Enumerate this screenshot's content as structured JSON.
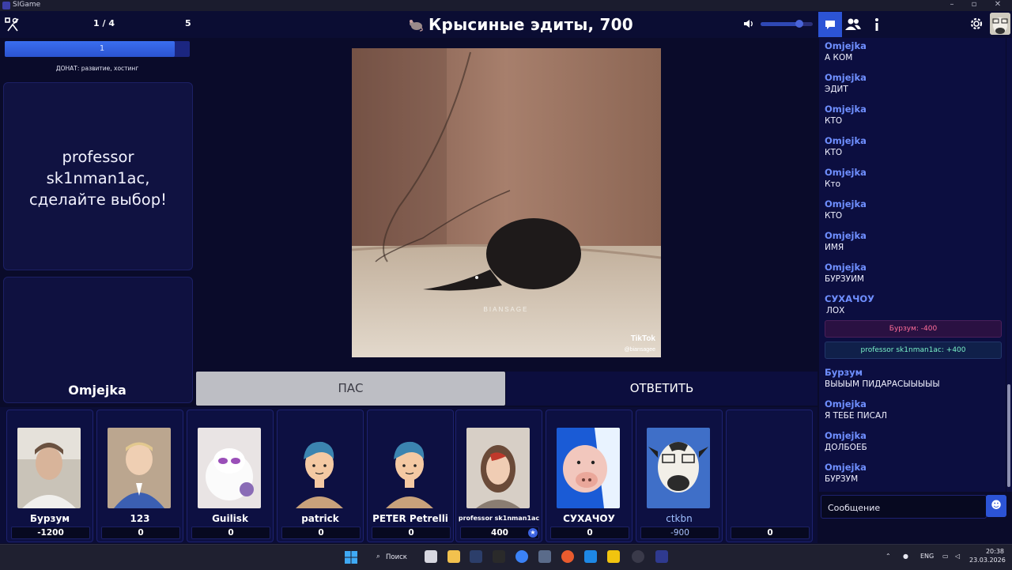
{
  "window": {
    "app_name": "SIGame"
  },
  "topbar": {
    "round": "1 / 4",
    "round_number": "5",
    "title": "Крысиные эдиты, 700"
  },
  "left_panel": {
    "progress_label": "1",
    "progress_fraction": 0.92,
    "donate": "ДОНАТ: развитие, хостинг",
    "prompt": "professor sk1nman1ac, сделайте выбор!",
    "chooser": "Omjejka"
  },
  "media": {
    "watermark": "BIANSAGE",
    "tiktok_label": "TikTok",
    "tiktok_handle": "@biansagee"
  },
  "buttons": {
    "pass": "ПАС",
    "answer": "ОТВЕТИТЬ"
  },
  "players": [
    {
      "name": "Бурзум",
      "score": "-1200"
    },
    {
      "name": "123",
      "score": "0"
    },
    {
      "name": "Guilisk",
      "score": "0"
    },
    {
      "name": "patrick",
      "score": "0"
    },
    {
      "name": "PETER Petrelli",
      "score": "0"
    },
    {
      "name": "professor sk1nman1ac",
      "score": "400"
    },
    {
      "name": "СУХАЧОУ",
      "score": "0"
    },
    {
      "name": "ctkbn",
      "score": "-900"
    },
    {
      "name": "",
      "score": "0"
    }
  ],
  "chat": {
    "messages": [
      {
        "author": "Omjejka",
        "text": "А КОМ"
      },
      {
        "author": "Omjejka",
        "text": "ЭДИТ"
      },
      {
        "author": "Omjejka",
        "text": "КТО"
      },
      {
        "author": "Omjejka",
        "text": "КТО"
      },
      {
        "author": "Omjejka",
        "text": "Кто"
      },
      {
        "author": "Omjejka",
        "text": "КТО"
      },
      {
        "author": "Omjejka",
        "text": "ИМЯ"
      },
      {
        "author": "Omjejka",
        "text": "БУРЗУИМ"
      },
      {
        "author": "СУХАЧОУ",
        "text": "ЛОХ"
      },
      {
        "author": "Бурзум",
        "text": "ВЫЫЫМ ПИДАРАСЫЫЫЫЫ"
      },
      {
        "author": "Omjejka",
        "text": "Я ТЕБЕ ПИСАЛ"
      },
      {
        "author": "Omjejka",
        "text": "ДОЛБОЕБ"
      },
      {
        "author": "Omjejka",
        "text": "БУРЗУМ"
      }
    ],
    "system": {
      "minus": "Бурзум: -400",
      "plus": "professor sk1nman1ac: +400"
    },
    "input_placeholder": "Сообщение"
  },
  "taskbar": {
    "search": "Поиск",
    "lang": "ENG",
    "time": "20:38",
    "date": "23.03.2026"
  }
}
